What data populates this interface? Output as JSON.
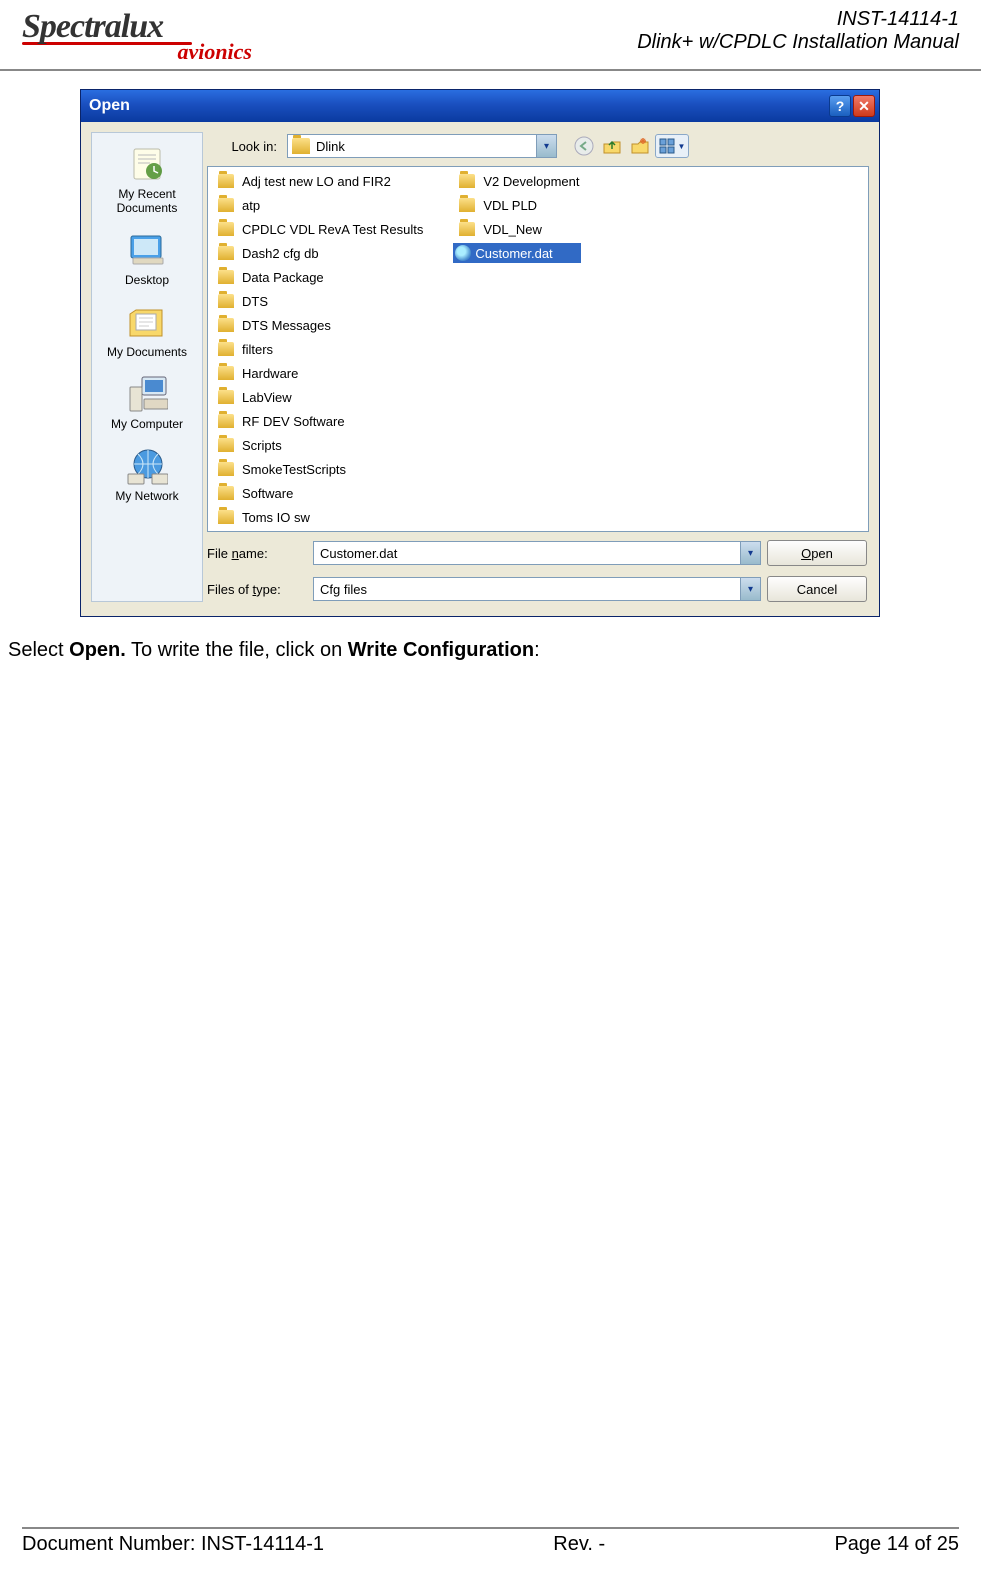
{
  "header": {
    "logo_top": "Spectralux",
    "logo_bottom": "avionics",
    "doc_id": "INST-14114-1",
    "doc_title": "Dlink+ w/CPDLC Installation Manual"
  },
  "dialog": {
    "title": "Open",
    "lookin_label": "Look in:",
    "lookin_value": "Dlink",
    "places": [
      "My Recent Documents",
      "Desktop",
      "My Documents",
      "My Computer",
      "My Network"
    ],
    "files_col1": [
      "Adj test new LO and FIR2",
      "atp",
      "CPDLC VDL RevA Test Results",
      "Dash2 cfg db",
      "Data Package",
      "DTS",
      "DTS Messages",
      "filters",
      "Hardware",
      "LabView",
      "RF DEV Software",
      "Scripts",
      "SmokeTestScripts",
      "Software",
      "Toms IO sw"
    ],
    "files_col2": [
      {
        "name": "V2 Development",
        "type": "folder"
      },
      {
        "name": "VDL PLD",
        "type": "folder"
      },
      {
        "name": "VDL_New",
        "type": "folder"
      },
      {
        "name": "Customer.dat",
        "type": "dat",
        "selected": true
      }
    ],
    "filename_label": "File name:",
    "filename_value": "Customer.dat",
    "filetype_label": "Files of type:",
    "filetype_value": "Cfg files",
    "open_btn": "Open",
    "cancel_btn": "Cancel"
  },
  "instruction": {
    "pre": "Select ",
    "b1": "Open.",
    "mid": " To write the file, click on ",
    "b2": "Write Configuration",
    "post": ":"
  },
  "footer": {
    "left": "Document Number:  INST-14114-1",
    "mid": "Rev. -",
    "right": "Page 14 of 25"
  }
}
